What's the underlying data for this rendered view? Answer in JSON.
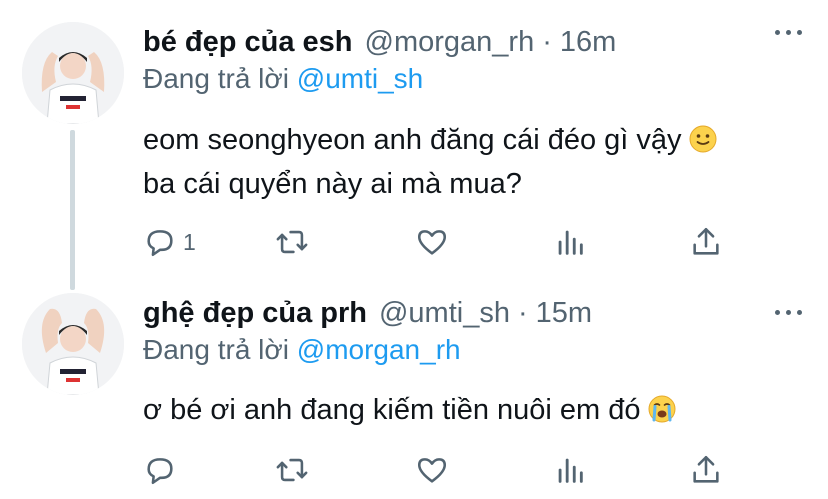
{
  "tweets": [
    {
      "display_name": "bé đẹp của esh",
      "handle": "@morgan_rh",
      "separator": "·",
      "time": "16m",
      "replying_prefix": "Đang trả lời",
      "replying_to": "@umti_sh",
      "text_line1": "eom seonghyeon anh đăng cái đéo gì vậy",
      "text_line1_emoji": "slightly-smiling-face",
      "text_line2": "ba cái quyển này ai mà mua?",
      "reply_count": "1"
    },
    {
      "display_name": "ghệ đẹp của prh",
      "handle": "@umti_sh",
      "separator": "·",
      "time": "15m",
      "replying_prefix": "Đang trả lời",
      "replying_to": "@morgan_rh",
      "text_line1": "ơ bé ơi anh đang kiếm tiền nuôi em đó",
      "text_line1_emoji": "loudly-crying-face",
      "reply_count": ""
    }
  ],
  "colors": {
    "link": "#1d9bf0",
    "secondary": "#536471",
    "text": "#0f1419",
    "thread_line": "#cfd9de"
  },
  "icons": [
    "reply-icon",
    "retweet-icon",
    "like-icon",
    "analytics-icon",
    "share-icon",
    "more-icon"
  ]
}
